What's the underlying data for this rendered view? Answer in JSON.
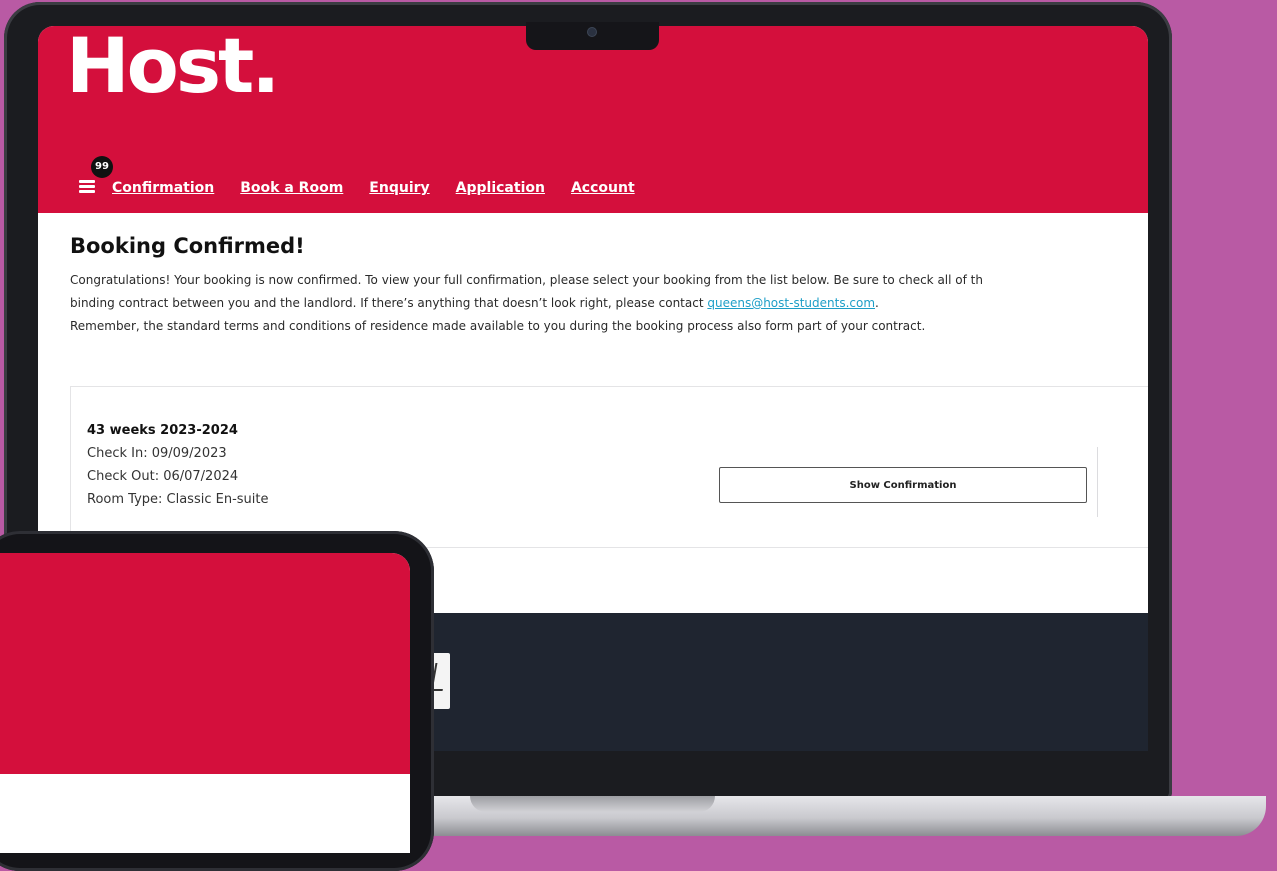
{
  "colors": {
    "background": "#b95aa4",
    "brand_red": "#d40f3c",
    "footer": "#1f2530",
    "link": "#1d9ec7"
  },
  "header": {
    "logo_text": "Host.",
    "notification_count": "99",
    "menu_icon": "hamburger-menu-icon",
    "nav": [
      {
        "label": "Confirmation"
      },
      {
        "label": "Book a Room"
      },
      {
        "label": "Enquiry"
      },
      {
        "label": "Application"
      },
      {
        "label": "Account"
      }
    ]
  },
  "main": {
    "title": "Booking Confirmed!",
    "intro_line1": "Congratulations! Your booking is now confirmed. To view your full confirmation, please select your booking from the list below. Be sure to check all of th",
    "intro_line2_prefix": "binding contract between you and the landlord. If there’s anything that doesn’t look right, please contact ",
    "contact_email": "queens@host-students.com",
    "intro_line2_suffix": ".",
    "intro_line3": "Remember, the standard terms and conditions of residence made available to you during the booking process also form part of your contract."
  },
  "booking": {
    "title": "43 weeks 2023-2024",
    "check_in": "Check In: 09/09/2023",
    "check_out": "Check Out: 06/07/2024",
    "room_type": "Room Type: Classic En-suite",
    "button_label": "Show Confirmation"
  }
}
